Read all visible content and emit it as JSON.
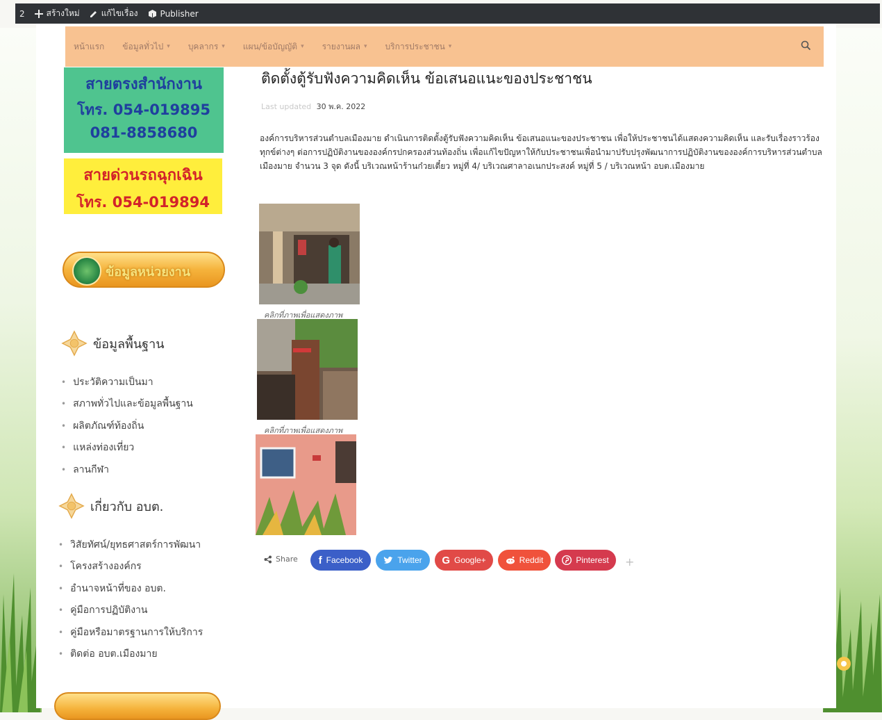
{
  "admin_bar": {
    "number": "2",
    "new_label": "สร้างใหม่",
    "edit_label": "แก้ไขเรื่อง",
    "publisher_label": "Publisher"
  },
  "nav": {
    "items": [
      {
        "label": "หน้าแรก",
        "has_caret": false
      },
      {
        "label": "ข้อมูลทั่วไป",
        "has_caret": true
      },
      {
        "label": "บุคลากร",
        "has_caret": true
      },
      {
        "label": "แผน/ข้อบัญญัติ",
        "has_caret": true
      },
      {
        "label": "รายงานผล",
        "has_caret": true
      },
      {
        "label": "บริการประชาชน",
        "has_caret": true
      }
    ],
    "background": "#f8c291"
  },
  "sidebar": {
    "hotline_office": {
      "title": "สายตรงสำนักงาน",
      "phone1": "โทร. 054-019895",
      "phone2": "081-8858680"
    },
    "hotline_emergency": {
      "title": "สายด่วนรถฉุกเฉิน",
      "phone": "โทร. 054-019894"
    },
    "banner_text": "ข้อมูลหน่วยงาน",
    "basic_info": {
      "heading": "ข้อมูลพื้นฐาน",
      "items": [
        "ประวัติความเป็นมา",
        "สภาพทั่วไปและข้อมูลพื้นฐาน",
        "ผลิตภัณฑ์ท้องถิ่น",
        "แหล่งท่องเที่ยว",
        "ลานกีฬา"
      ]
    },
    "about": {
      "heading": "เกี่ยวกับ อบต.",
      "items": [
        "วิสัยทัศน์/ยุทธศาสตร์การพัฒนา",
        "โครงสร้างองค์กร",
        "อำนาจหน้าที่ของ อบต.",
        "คู่มือการปฏิบัติงาน",
        "คู่มือหรือมาตรฐานการให้บริการ",
        "ติดต่อ อบต.เมืองมาย"
      ]
    }
  },
  "article": {
    "title": "ติดตั้งตู้รับฟังความคิดเห็น ข้อเสนอแนะของประชาชน",
    "last_updated_label": "Last updated",
    "date": "30 พ.ค. 2022",
    "body": "องค์การบริหารส่วนตำบลเมืองมาย ดำเนินการติดตั้งตู้รับฟังความคิดเห็น ข้อเสนอแนะของประชาชน เพื่อให้ประชาชนได้แสดงความคิดเห็น และรับเรื่องราวร้องทุกข์ต่างๆ ต่อการปฏิบัติงานขององค์กรปกครองส่วนท้องถิ่น เพื่อแก้ไขปัญหาให้กับประชาชนเพื่อนำมาปรับปรุงพัฒนาการปฏิบัติงานขององค์การบริหารส่วนตำบลเมืองมาย จำนวน 3 จุด ดังนี้ บริเวณหน้าร้านก๋วยเตี๋ยว หมู่ที่ 4/ บริเวณศาลาอเนกประสงค์ หมู่ที่ 5 / บริเวณหน้า อบต.เมืองมาย",
    "captions": [
      "คลิกที่ภาพเพื่อแสดงภาพ",
      "คลิกที่ภาพเพื่อแสดงภาพ"
    ]
  },
  "share": {
    "label": "Share",
    "buttons": [
      {
        "label": "Facebook",
        "color": "#3b5fc8"
      },
      {
        "label": "Twitter",
        "color": "#4aa3ec"
      },
      {
        "label": "Google+",
        "color": "#e14a47"
      },
      {
        "label": "Reddit",
        "color": "#f0523b"
      },
      {
        "label": "Pinterest",
        "color": "#d53a4e"
      }
    ],
    "more": "+"
  }
}
